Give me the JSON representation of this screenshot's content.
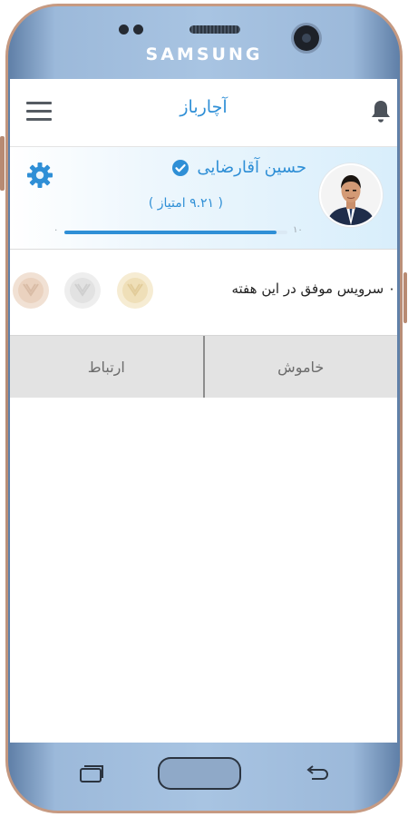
{
  "device": {
    "brand": "SAMSUNG"
  },
  "header": {
    "title": "آچارباز",
    "menu_icon": "hamburger-menu-icon",
    "bell_icon": "bell-icon"
  },
  "profile": {
    "name": "حسین آقارضایی",
    "score": "( ۹.۲۱ امتیاز )",
    "progress_min": "۰",
    "progress_max": "۱۰",
    "progress_value": 0.95,
    "verified_icon": "check-circle-icon",
    "settings_icon": "gear-icon"
  },
  "services": {
    "text": "۰ سرویس موفق در این هفته",
    "medals": [
      "bronze-medal",
      "silver-medal",
      "gold-medal"
    ]
  },
  "actions": {
    "off_label": "خاموش",
    "contact_label": "ارتباط"
  },
  "colors": {
    "accent": "#2f8fd6",
    "phone_body": "#a8c4e2",
    "action_bg": "#e3e3e3"
  }
}
